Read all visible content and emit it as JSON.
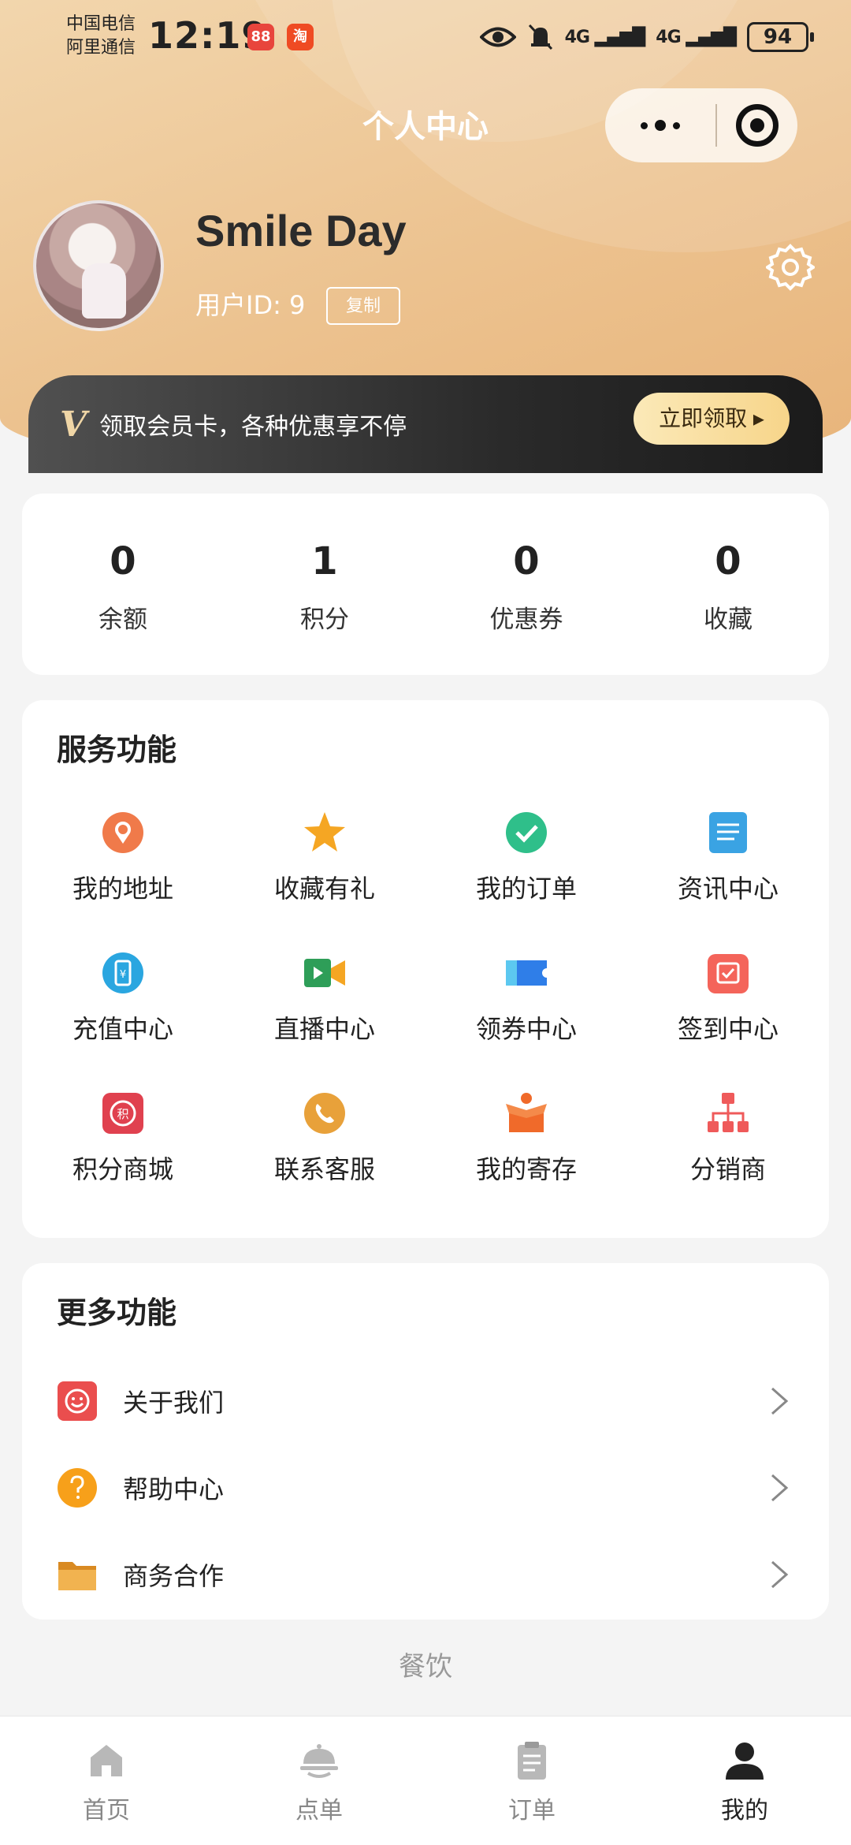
{
  "status_bar": {
    "url_fragment": "https://...com/1shop15081",
    "carrier_1": "中国电信",
    "carrier_2": "阿里通信",
    "time": "12:19",
    "signal_1": "4G",
    "signal_2": "4G",
    "battery": "94"
  },
  "nav": {
    "title": "个人中心"
  },
  "profile": {
    "name": "Smile Day",
    "user_id": "用户ID: 9",
    "copy_label": "复制"
  },
  "vip": {
    "logo": "V",
    "text": "领取会员卡，各种优惠享不停",
    "button": "立即领取 ▸"
  },
  "stats": [
    {
      "value": "0",
      "label": "余额"
    },
    {
      "value": "1",
      "label": "积分"
    },
    {
      "value": "0",
      "label": "优惠券"
    },
    {
      "value": "0",
      "label": "收藏"
    }
  ],
  "services": {
    "title": "服务功能",
    "items": [
      {
        "label": "我的地址",
        "icon": "location-icon",
        "color": "#f07a4a"
      },
      {
        "label": "收藏有礼",
        "icon": "star-icon",
        "color": "#f5a623"
      },
      {
        "label": "我的订单",
        "icon": "check-circle-icon",
        "color": "#2fbf8a"
      },
      {
        "label": "资讯中心",
        "icon": "document-icon",
        "color": "#3aa3e3"
      },
      {
        "label": "充值中心",
        "icon": "phone-recharge-icon",
        "color": "#2aa6e0"
      },
      {
        "label": "直播中心",
        "icon": "live-video-icon",
        "color": "#2e9e58"
      },
      {
        "label": "领券中心",
        "icon": "coupon-icon",
        "color": "#2f7ee8"
      },
      {
        "label": "签到中心",
        "icon": "calendar-check-icon",
        "color": "#f4645a"
      },
      {
        "label": "积分商城",
        "icon": "points-mall-icon",
        "color": "#e0414f"
      },
      {
        "label": "联系客服",
        "icon": "phone-call-icon",
        "color": "#e8a13a"
      },
      {
        "label": "我的寄存",
        "icon": "storage-box-icon",
        "color": "#f06a2a"
      },
      {
        "label": "分销商",
        "icon": "org-chart-icon",
        "color": "#ef5a5a"
      }
    ]
  },
  "more": {
    "title": "更多功能",
    "items": [
      {
        "label": "关于我们",
        "icon": "smile-face-icon",
        "color": "#ea4e4e"
      },
      {
        "label": "帮助中心",
        "icon": "question-icon",
        "color": "#f7a01a"
      },
      {
        "label": "商务合作",
        "icon": "folder-icon",
        "color": "#e9a33e"
      }
    ]
  },
  "footer": {
    "text": "餐饮"
  },
  "tabs": [
    {
      "label": "首页",
      "icon": "home-icon",
      "active": false
    },
    {
      "label": "点单",
      "icon": "dish-cover-icon",
      "active": false
    },
    {
      "label": "订单",
      "icon": "clipboard-icon",
      "active": false
    },
    {
      "label": "我的",
      "icon": "user-icon",
      "active": true
    }
  ]
}
